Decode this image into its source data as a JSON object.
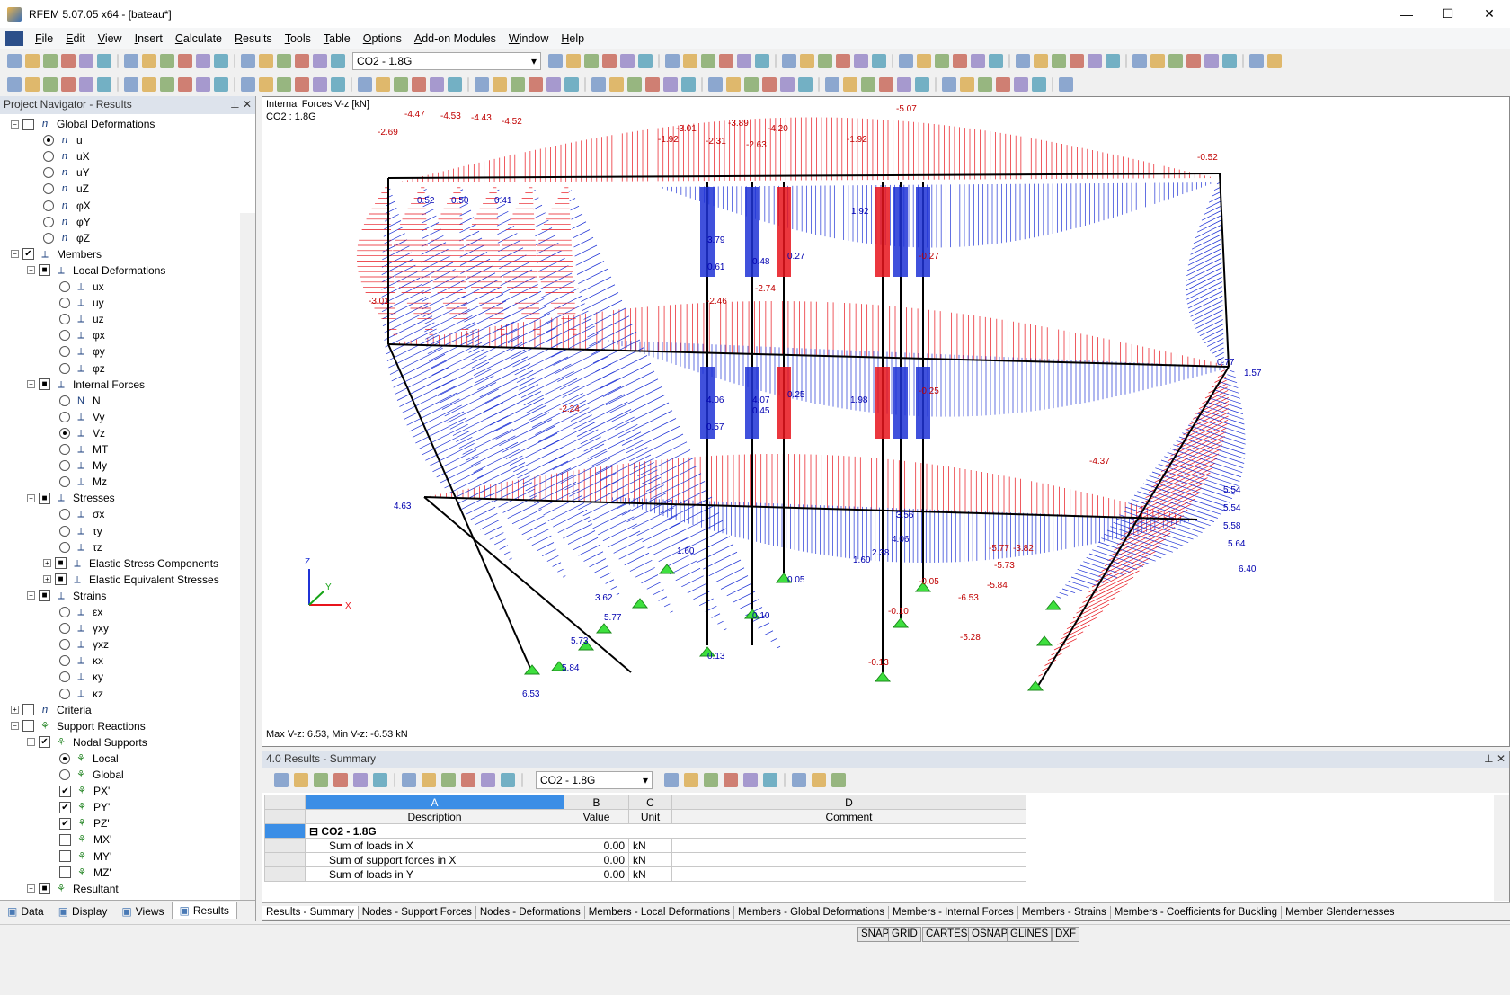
{
  "window": {
    "title": "RFEM 5.07.05 x64 - [bateau*]",
    "minimize": "—",
    "maximize": "☐",
    "close": "✕"
  },
  "menu": [
    "File",
    "Edit",
    "View",
    "Insert",
    "Calculate",
    "Results",
    "Tools",
    "Table",
    "Options",
    "Add-on Modules",
    "Window",
    "Help"
  ],
  "toolbar": {
    "load_case": "CO2 - 1.8G"
  },
  "navigator": {
    "title": "Project Navigator - Results",
    "items": [
      {
        "label": "Global Deformations",
        "level": 0,
        "exp": "−",
        "chk": "",
        "icon": "ⴖ"
      },
      {
        "label": "u",
        "level": 2,
        "radio": true,
        "on": true,
        "icon": "ⴖ"
      },
      {
        "label": "uX",
        "level": 2,
        "radio": true,
        "icon": "ⴖ"
      },
      {
        "label": "uY",
        "level": 2,
        "radio": true,
        "icon": "ⴖ"
      },
      {
        "label": "uZ",
        "level": 2,
        "radio": true,
        "icon": "ⴖ"
      },
      {
        "label": "φX",
        "level": 2,
        "radio": true,
        "icon": "ⴖ"
      },
      {
        "label": "φY",
        "level": 2,
        "radio": true,
        "icon": "ⴖ"
      },
      {
        "label": "φZ",
        "level": 2,
        "radio": true,
        "icon": "ⴖ"
      },
      {
        "label": "Members",
        "level": 0,
        "exp": "−",
        "chk": "✔",
        "icon": "⟂"
      },
      {
        "label": "Local Deformations",
        "level": 1,
        "exp": "−",
        "chk": "■",
        "icon": "⟂"
      },
      {
        "label": "ux",
        "level": 3,
        "radio": true,
        "icon": "⟂"
      },
      {
        "label": "uy",
        "level": 3,
        "radio": true,
        "icon": "⟂"
      },
      {
        "label": "uz",
        "level": 3,
        "radio": true,
        "icon": "⟂"
      },
      {
        "label": "φx",
        "level": 3,
        "radio": true,
        "icon": "⟂"
      },
      {
        "label": "φy",
        "level": 3,
        "radio": true,
        "icon": "⟂"
      },
      {
        "label": "φz",
        "level": 3,
        "radio": true,
        "icon": "⟂"
      },
      {
        "label": "Internal Forces",
        "level": 1,
        "exp": "−",
        "chk": "■",
        "icon": "⟂"
      },
      {
        "label": "N",
        "level": 3,
        "radio": true,
        "icon": "N"
      },
      {
        "label": "Vy",
        "level": 3,
        "radio": true,
        "icon": "⟂"
      },
      {
        "label": "Vz",
        "level": 3,
        "radio": true,
        "on": true,
        "icon": "⟂"
      },
      {
        "label": "MT",
        "level": 3,
        "radio": true,
        "icon": "⟂"
      },
      {
        "label": "My",
        "level": 3,
        "radio": true,
        "icon": "⟂"
      },
      {
        "label": "Mz",
        "level": 3,
        "radio": true,
        "icon": "⟂"
      },
      {
        "label": "Stresses",
        "level": 1,
        "exp": "−",
        "chk": "■",
        "icon": "⟂"
      },
      {
        "label": "σx",
        "level": 3,
        "radio": true,
        "icon": "⟂"
      },
      {
        "label": "τy",
        "level": 3,
        "radio": true,
        "icon": "⟂"
      },
      {
        "label": "τz",
        "level": 3,
        "radio": true,
        "icon": "⟂"
      },
      {
        "label": "Elastic Stress Components",
        "level": 2,
        "exp": "+",
        "chk": "■",
        "icon": "⟂"
      },
      {
        "label": "Elastic Equivalent Stresses",
        "level": 2,
        "exp": "+",
        "chk": "■",
        "icon": "⟂"
      },
      {
        "label": "Strains",
        "level": 1,
        "exp": "−",
        "chk": "■",
        "icon": "⟂"
      },
      {
        "label": "εx",
        "level": 3,
        "radio": true,
        "icon": "⟂"
      },
      {
        "label": "γxy",
        "level": 3,
        "radio": true,
        "icon": "⟂"
      },
      {
        "label": "γxz",
        "level": 3,
        "radio": true,
        "icon": "⟂"
      },
      {
        "label": "κx",
        "level": 3,
        "radio": true,
        "icon": "⟂"
      },
      {
        "label": "κy",
        "level": 3,
        "radio": true,
        "icon": "⟂"
      },
      {
        "label": "κz",
        "level": 3,
        "radio": true,
        "icon": "⟂"
      },
      {
        "label": "Criteria",
        "level": 0,
        "exp": "+",
        "chk": "",
        "icon": "ⴖ"
      },
      {
        "label": "Support Reactions",
        "level": 0,
        "exp": "−",
        "chk": "",
        "icon": "⚘",
        "sup": true
      },
      {
        "label": "Nodal Supports",
        "level": 1,
        "exp": "−",
        "chk": "✔",
        "icon": "⚘",
        "sup": true
      },
      {
        "label": "Local",
        "level": 3,
        "radio": true,
        "on": true,
        "icon": "⚘",
        "sup": true
      },
      {
        "label": "Global",
        "level": 3,
        "radio": true,
        "icon": "⚘",
        "sup": true
      },
      {
        "label": "PX'",
        "level": 3,
        "chk": "✔",
        "icon": "⚘",
        "sup": true
      },
      {
        "label": "PY'",
        "level": 3,
        "chk": "✔",
        "icon": "⚘",
        "sup": true
      },
      {
        "label": "PZ'",
        "level": 3,
        "chk": "✔",
        "icon": "⚘",
        "sup": true
      },
      {
        "label": "MX'",
        "level": 3,
        "chk": "",
        "icon": "⚘",
        "sup": true
      },
      {
        "label": "MY'",
        "level": 3,
        "chk": "",
        "icon": "⚘",
        "sup": true
      },
      {
        "label": "MZ'",
        "level": 3,
        "chk": "",
        "icon": "⚘",
        "sup": true
      },
      {
        "label": "Resultant",
        "level": 1,
        "exp": "−",
        "chk": "■",
        "icon": "⚘",
        "sup": true
      },
      {
        "label": "R",
        "level": 3,
        "radio": true,
        "on": true,
        "icon": "⚘",
        "sup": true
      }
    ],
    "tabs": [
      "Data",
      "Display",
      "Views",
      "Results"
    ]
  },
  "view": {
    "title_line1": "Internal Forces V-z [kN]",
    "title_line2": "CO2 : 1.8G",
    "summary": "Max V-z: 6.53, Min V-z: -6.53 kN",
    "axis_x": "X",
    "axis_y": "Y",
    "axis_z": "Z",
    "labels": [
      {
        "t": "-2.69",
        "c": "r"
      },
      {
        "t": "-4.47",
        "c": "r"
      },
      {
        "t": "-4.53",
        "c": "r"
      },
      {
        "t": "-4.43",
        "c": "r"
      },
      {
        "t": "-4.52",
        "c": "r"
      },
      {
        "t": "-1.92",
        "c": "r"
      },
      {
        "t": "-3.01",
        "c": "r"
      },
      {
        "t": "-2.31",
        "c": "r"
      },
      {
        "t": "-3.89",
        "c": "r"
      },
      {
        "t": "-2.63",
        "c": "r"
      },
      {
        "t": "-4.20",
        "c": "r"
      },
      {
        "t": "-1.92",
        "c": "r"
      },
      {
        "t": "-5.07",
        "c": "r"
      },
      {
        "t": "-0.52",
        "c": "r"
      },
      {
        "t": "-3.01",
        "c": "r"
      },
      {
        "t": "-2.46",
        "c": "r"
      },
      {
        "t": "-2.74",
        "c": "r"
      },
      {
        "t": "-0.27",
        "c": "r"
      },
      {
        "t": "-0.25",
        "c": "r"
      },
      {
        "t": "-2.24",
        "c": "r"
      },
      {
        "t": "-4.37",
        "c": "r"
      },
      {
        "t": "-5.77",
        "c": "r"
      },
      {
        "t": "-3.82",
        "c": "r"
      },
      {
        "t": "-5.73",
        "c": "r"
      },
      {
        "t": "-5.84",
        "c": "r"
      },
      {
        "t": "-6.53",
        "c": "r"
      },
      {
        "t": "-5.28",
        "c": "r"
      },
      {
        "t": "-0.05",
        "c": "r"
      },
      {
        "t": "-0.10",
        "c": "r"
      },
      {
        "t": "-0.13",
        "c": "r"
      },
      {
        "t": "0.52",
        "c": "b"
      },
      {
        "t": "0.50",
        "c": "b"
      },
      {
        "t": "0.41",
        "c": "b"
      },
      {
        "t": "1.92",
        "c": "b"
      },
      {
        "t": "3.79",
        "c": "b"
      },
      {
        "t": "0.61",
        "c": "b"
      },
      {
        "t": "0.48",
        "c": "b"
      },
      {
        "t": "0.27",
        "c": "b"
      },
      {
        "t": "0.77",
        "c": "b"
      },
      {
        "t": "1.57",
        "c": "b"
      },
      {
        "t": "0.25",
        "c": "b"
      },
      {
        "t": "4.06",
        "c": "b"
      },
      {
        "t": "4.07",
        "c": "b"
      },
      {
        "t": "0.45",
        "c": "b"
      },
      {
        "t": "0.57",
        "c": "b"
      },
      {
        "t": "1.98",
        "c": "b"
      },
      {
        "t": "4.63",
        "c": "b"
      },
      {
        "t": "1.60",
        "c": "b"
      },
      {
        "t": "1.60",
        "c": "b"
      },
      {
        "t": "5.54",
        "c": "b"
      },
      {
        "t": "5.54",
        "c": "b"
      },
      {
        "t": "5.58",
        "c": "b"
      },
      {
        "t": "5.64",
        "c": "b"
      },
      {
        "t": "6.40",
        "c": "b"
      },
      {
        "t": "0.05",
        "c": "b"
      },
      {
        "t": "0.10",
        "c": "b"
      },
      {
        "t": "0.13",
        "c": "b"
      },
      {
        "t": "3.62",
        "c": "b"
      },
      {
        "t": "5.77",
        "c": "b"
      },
      {
        "t": "5.73",
        "c": "b"
      },
      {
        "t": "5.84",
        "c": "b"
      },
      {
        "t": "6.53",
        "c": "b"
      },
      {
        "t": "2.38",
        "c": "b"
      },
      {
        "t": "4.06",
        "c": "b"
      },
      {
        "t": "3.56",
        "c": "b"
      }
    ]
  },
  "results": {
    "title": "4.0 Results - Summary",
    "load_case": "CO2 - 1.8G",
    "columns": [
      {
        "letter": "A",
        "name": "Description"
      },
      {
        "letter": "B",
        "name": "Value"
      },
      {
        "letter": "C",
        "name": "Unit"
      },
      {
        "letter": "D",
        "name": "Comment"
      }
    ],
    "group": "CO2 - 1.8G",
    "rows": [
      {
        "desc": "Sum of loads in X",
        "value": "0.00",
        "unit": "kN"
      },
      {
        "desc": "Sum of support forces in X",
        "value": "0.00",
        "unit": "kN"
      },
      {
        "desc": "Sum of loads in Y",
        "value": "0.00",
        "unit": "kN"
      }
    ],
    "tabs": [
      "Results - Summary",
      "Nodes - Support Forces",
      "Nodes - Deformations",
      "Members - Local Deformations",
      "Members - Global Deformations",
      "Members - Internal Forces",
      "Members - Strains",
      "Members - Coefficients for Buckling",
      "Member Slendernesses"
    ]
  },
  "status": [
    "SNAP",
    "GRID",
    "CARTES",
    "OSNAP",
    "GLINES",
    "DXF"
  ]
}
